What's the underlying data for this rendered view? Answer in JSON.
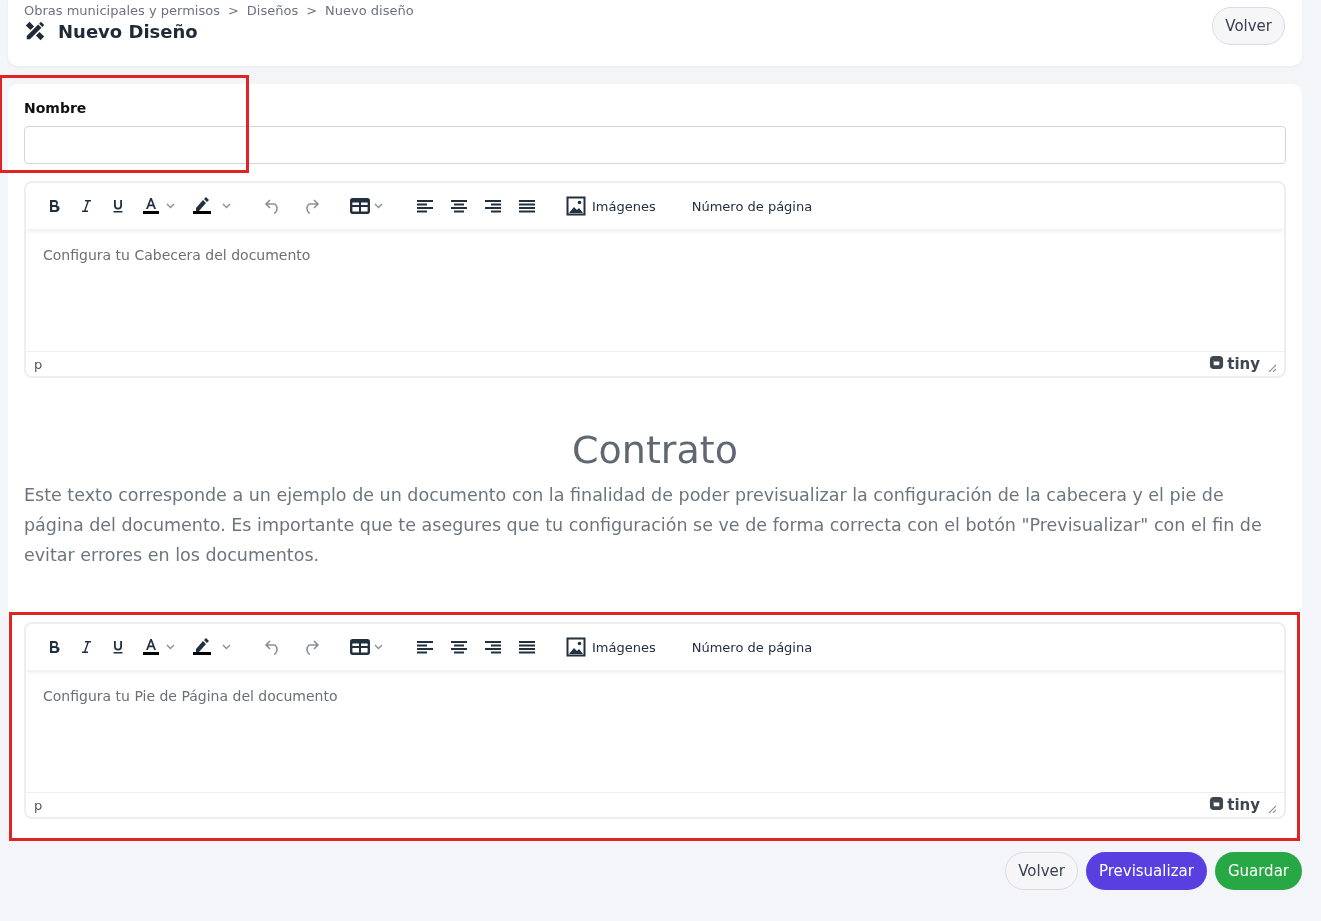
{
  "header": {
    "breadcrumb": [
      "Obras municipales y permisos",
      "Diseños",
      "Nuevo diseño"
    ],
    "separator": ">",
    "title": "Nuevo Diseño",
    "back_button": "Volver"
  },
  "name_field": {
    "label": "Nombre",
    "highlighted": true
  },
  "header_editor": {
    "highlighted": false,
    "toolbar": [
      {
        "kind": "bold"
      },
      {
        "kind": "italic"
      },
      {
        "kind": "underline"
      },
      {
        "kind": "text-color"
      },
      {
        "kind": "highlight"
      },
      {
        "kind": "undo"
      },
      {
        "kind": "redo"
      },
      {
        "kind": "table"
      },
      {
        "kind": "align-left"
      },
      {
        "kind": "align-center"
      },
      {
        "kind": "align-right"
      },
      {
        "kind": "justify"
      },
      {
        "kind": "image",
        "label": "Imágenes"
      },
      {
        "kind": "text",
        "label": "Número de página"
      }
    ],
    "placeholder": "Configura tu Cabecera del documento",
    "path": "p",
    "brand": "tiny"
  },
  "contract": {
    "title": "Contrato",
    "body": "Este texto corresponde a un ejemplo de un documento con la finalidad de poder previsualizar la configuración de la cabecera y el pie de página del documento. Es importante que te asegures que tu configuración se ve de forma correcta con el botón \"Previsualizar\" con el fin de evitar errores en los documentos."
  },
  "footer_editor": {
    "highlighted": true,
    "toolbar": [
      {
        "kind": "bold"
      },
      {
        "kind": "italic"
      },
      {
        "kind": "underline"
      },
      {
        "kind": "text-color"
      },
      {
        "kind": "highlight"
      },
      {
        "kind": "undo"
      },
      {
        "kind": "redo"
      },
      {
        "kind": "table"
      },
      {
        "kind": "align-left"
      },
      {
        "kind": "align-center"
      },
      {
        "kind": "align-right"
      },
      {
        "kind": "justify"
      },
      {
        "kind": "image",
        "label": "Imágenes"
      },
      {
        "kind": "text",
        "label": "Número de página"
      }
    ],
    "placeholder": "Configura tu Pie de Página del documento",
    "path": "p",
    "brand": "tiny"
  },
  "actions": [
    {
      "label": "Volver",
      "kind": "secondary"
    },
    {
      "label": "Previsualizar",
      "kind": "preview"
    },
    {
      "label": "Guardar",
      "kind": "save"
    }
  ]
}
